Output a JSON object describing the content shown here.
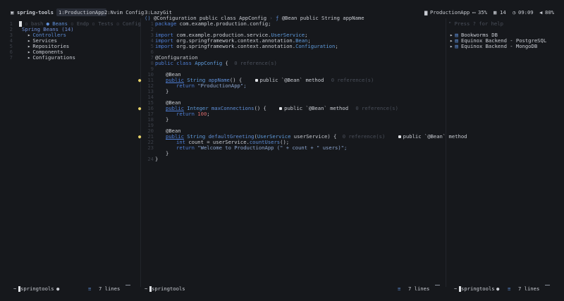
{
  "tmux": {
    "session": "spring-tools",
    "windows": [
      "1:ProductionApp",
      "2:Nvim Config",
      "3:LazyGit"
    ],
    "right": {
      "project": "ProductionApp",
      "battery": "35%",
      "calendar": "14",
      "clock": "09:09",
      "volume": "80%"
    }
  },
  "left": {
    "tabs": {
      "bash": "bash",
      "beans": "Beans",
      "endp": "Endp",
      "tests": "Tests",
      "config": "Config"
    },
    "tree_title": "Spring Beans (14)",
    "items": [
      "Controllers",
      "Services",
      "Repositories",
      "Components",
      "Configurations"
    ],
    "line_numbers": [
      "1",
      "2",
      "3",
      "4",
      "5",
      "6",
      "7"
    ],
    "status": {
      "name": "springtools",
      "lines": "7 lines"
    }
  },
  "editor": {
    "winbar": {
      "left": "@Configuration public class AppConfig",
      "right": "@Bean public String appName"
    },
    "line_numbers": [
      "1",
      "2",
      "3",
      "4",
      "5",
      "6",
      "7",
      "8",
      "9",
      "10",
      "11",
      "12",
      "13",
      "14",
      "15",
      "16",
      "17",
      "18",
      "19",
      "20",
      "21",
      "22",
      "23",
      "24"
    ],
    "package_kw": "package",
    "package_name": "com.example.production.config;",
    "imports": [
      {
        "kw": "import",
        "path": "com.example.production.service.",
        "cls": "UserService",
        "end": ";"
      },
      {
        "kw": "import",
        "path": "org.springframework.context.annotation.",
        "cls": "Bean",
        "end": ";"
      },
      {
        "kw": "import",
        "path": "org.springframework.context.annotation.",
        "cls": "Configuration",
        "end": ";"
      }
    ],
    "ann_config": "@Configuration",
    "class_decl": {
      "kw": "public class",
      "name": "AppConfig",
      "brace": "{",
      "refs": "0 reference(s)"
    },
    "bean_ann": "@Bean",
    "methods": [
      {
        "mods": "public",
        "ret": "String",
        "name": "appName",
        "sig": "() {",
        "refs": "0 reference(s)",
        "hint": "public `@Bean` method"
      },
      {
        "mods": "public",
        "ret": "Integer",
        "name": "maxConnections",
        "sig": "() {",
        "refs": "0 reference(s)",
        "hint": "public `@Bean` method"
      },
      {
        "mods": "public",
        "ret": "String",
        "name": "defaultGreeting",
        "sig_open": "(",
        "param_type": "UserService",
        "param_name": "userService) {",
        "refs": "0 reference(s)",
        "hint": "public `@Bean` method"
      }
    ],
    "return_kw": "return",
    "ret1": "\"ProductionApp\";",
    "ret2_num": "100",
    "ret2_end": ";",
    "int_kw": "int",
    "count_line_a": "count = userService.",
    "count_fn": "countUsers",
    "count_line_b": "();",
    "ret3": "\"Welcome to ProductionApp (\" + count + \" users)\";",
    "close": "}",
    "status": {
      "name": "springtools",
      "lines": "7 lines"
    }
  },
  "right": {
    "help": "\" Press ? for help",
    "dbs": [
      "Bookworms DB",
      "Equinox Backend - PostgreSQL",
      "Equinox Backend - MongoDB"
    ],
    "status": {
      "name": "springtools",
      "lines": "7 lines"
    }
  }
}
